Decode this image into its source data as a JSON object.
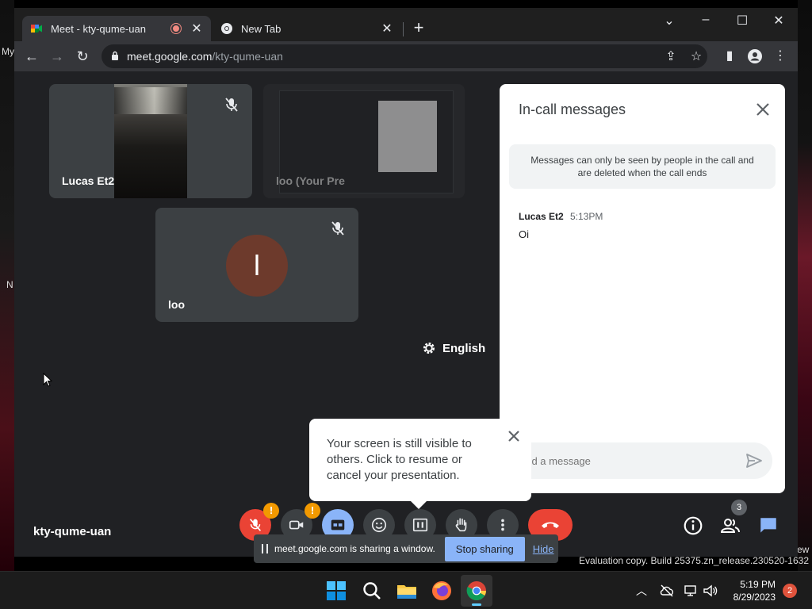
{
  "desktop": {
    "left_labels": [
      "My",
      "N"
    ],
    "right_label": "ew"
  },
  "browser": {
    "tabs": [
      {
        "title": "Meet - kty-qume-uan",
        "recording": true,
        "active": true
      },
      {
        "title": "New Tab",
        "active": false
      }
    ],
    "address": {
      "host": "meet.google.com",
      "path": "/kty-qume-uan"
    }
  },
  "meet": {
    "participants": [
      {
        "name": "Lucas Et2",
        "muted": true
      },
      {
        "name": "loo (Your Pre",
        "muted": false
      },
      {
        "name": "loo",
        "initial": "l",
        "muted": true
      }
    ],
    "caption_language": "English",
    "meeting_code": "kty-qume-uan",
    "participant_count": "3",
    "chat": {
      "title": "In-call messages",
      "notice": "Messages can only be seen by people in the call and are deleted when the call ends",
      "messages": [
        {
          "sender": "Lucas Et2",
          "time": "5:13PM",
          "text": "Oi"
        }
      ],
      "placeholder": "end a message"
    },
    "popup": {
      "text": "Your screen is still visible to others. Click to resume or cancel your presentation."
    },
    "warning_symbol": "!",
    "sharebar": {
      "text": "meet.google.com is sharing a window.",
      "stop_label": "Stop sharing",
      "hide_label": "Hide"
    }
  },
  "watermark": {
    "line": "Evaluation copy. Build 25375.zn_release.230520-1632"
  },
  "taskbar": {
    "time": "5:19 PM",
    "date": "8/29/2023",
    "notifications": "2",
    "apps": [
      "start-icon",
      "search-icon",
      "file-explorer-icon",
      "firefox-icon",
      "chrome-icon"
    ]
  },
  "colors": {
    "accent_blue": "#8ab4f8",
    "end_call_red": "#ea4335",
    "warning_orange": "#f29900",
    "avatar_brown": "#6d3a2c"
  }
}
